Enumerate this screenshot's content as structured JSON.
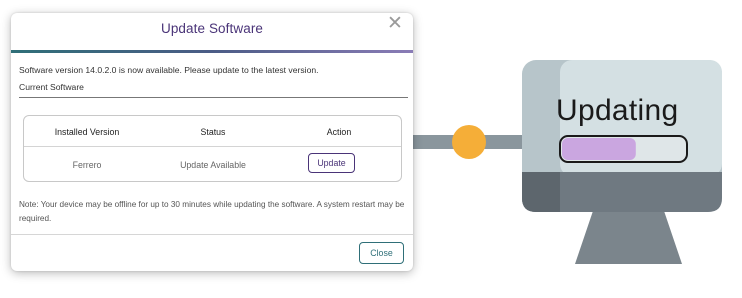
{
  "dialog": {
    "title": "Update Software",
    "close_icon": "close-icon",
    "message": "Software version 14.0.2.0 is now available. Please update to the latest version.",
    "section_label": "Current Software",
    "table": {
      "headers": [
        "Installed Version",
        "Status",
        "Action"
      ],
      "rows": [
        {
          "installed_version": "Ferrero",
          "status": "Update Available",
          "action_label": "Update"
        }
      ]
    },
    "note": "Note: Your device may be offline for up to 30 minutes while updating the software. A system restart may be required.",
    "close_button_label": "Close"
  },
  "illustration": {
    "monitor_text": "Updating",
    "progress": 0.6,
    "colors": {
      "monitor_screen": "#d4e0e3",
      "monitor_bezel": "#b7c5ca",
      "monitor_base": "#707a81",
      "progress_fill": "#caa6e0",
      "connector": "#8a969d",
      "connector_dot": "#f5ae38"
    }
  },
  "colors": {
    "accent_purple": "#4a3478",
    "accent_teal": "#2f6f78"
  }
}
